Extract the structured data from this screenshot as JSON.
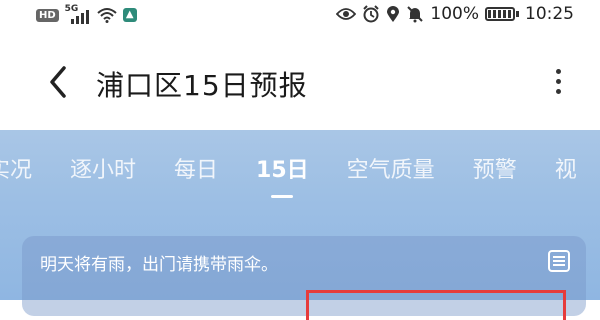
{
  "status_bar": {
    "network_badge": "HD",
    "signal_label": "5G",
    "battery_text": "100%",
    "time": "10:25"
  },
  "header": {
    "title": "浦口区15日预报"
  },
  "tabs": [
    {
      "label": "实况"
    },
    {
      "label": "逐小时"
    },
    {
      "label": "每日"
    },
    {
      "label": "15日",
      "active": true
    },
    {
      "label": "空气质量"
    },
    {
      "label": "预警"
    }
  ],
  "tab_overflow": "视",
  "notice": {
    "text": "明天将有雨，出门请携带雨伞。"
  },
  "colors": {
    "accent_blue": "#9dbfe4",
    "highlight_red": "#e63b3b"
  }
}
